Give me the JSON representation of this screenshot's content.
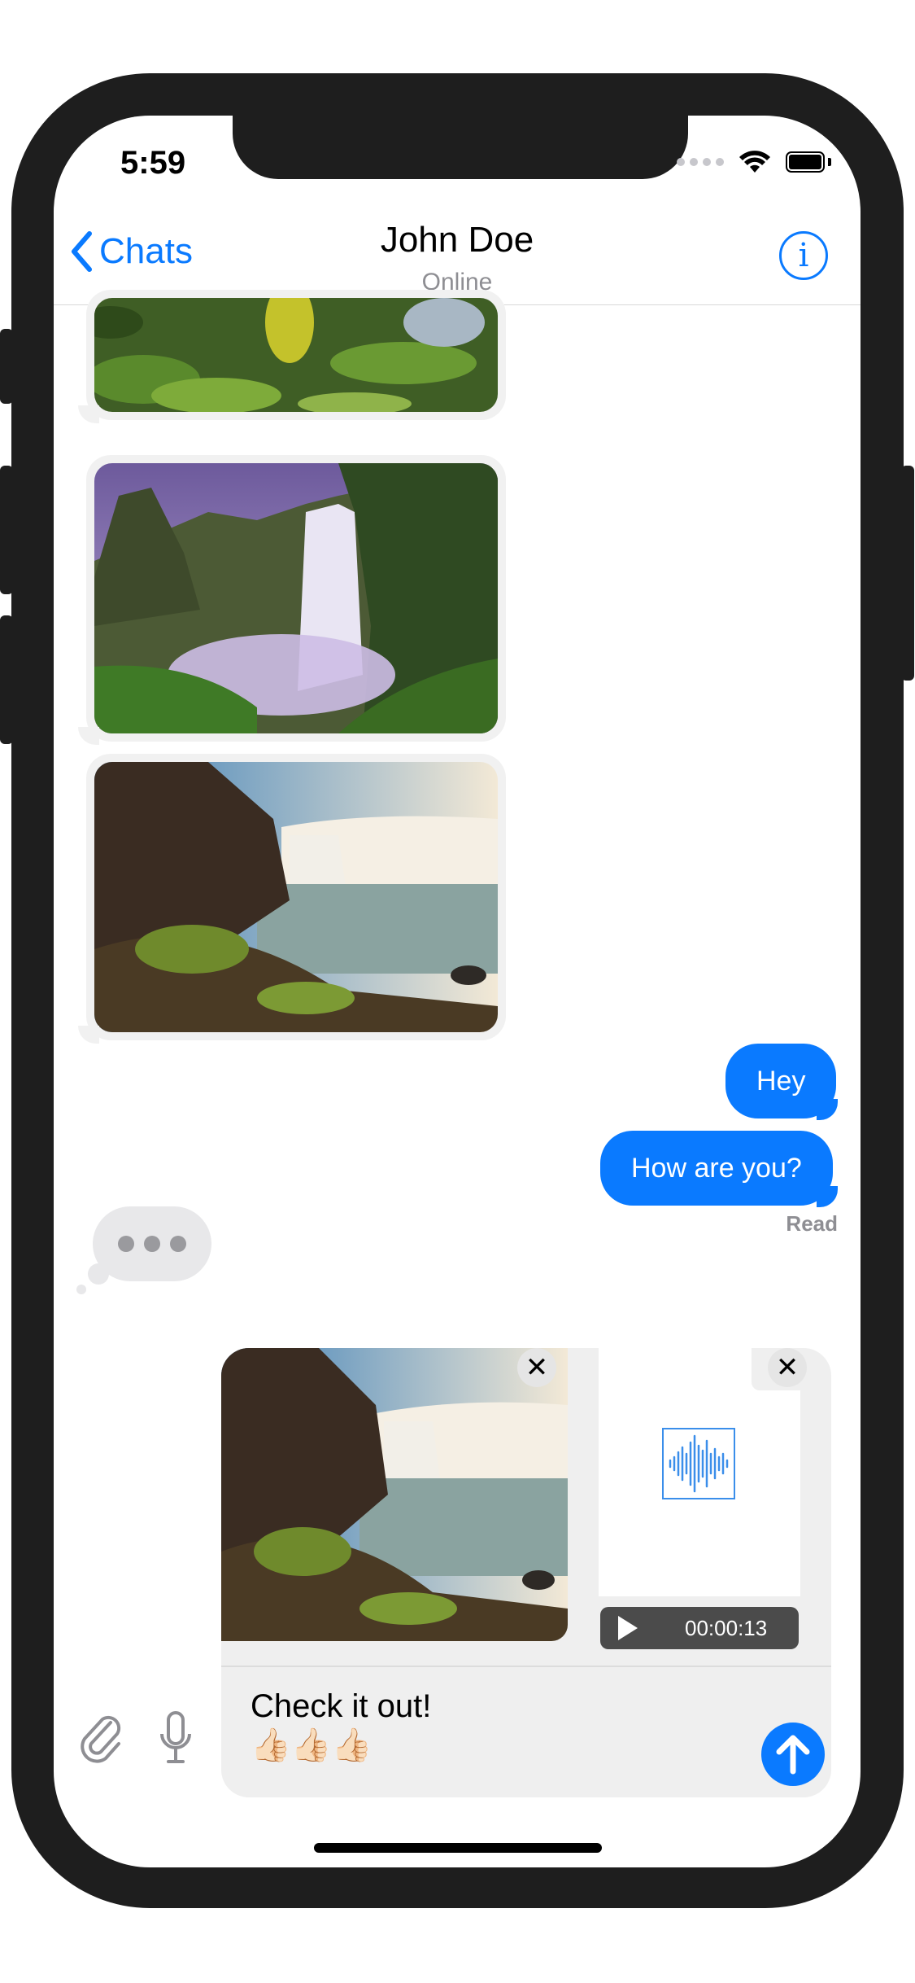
{
  "status_bar": {
    "time": "5:59"
  },
  "nav": {
    "back_label": "Chats",
    "title": "John Doe",
    "subtitle": "Online"
  },
  "messages": {
    "outgoing": [
      {
        "text": "Hey"
      },
      {
        "text": "How are you?"
      }
    ],
    "read_receipt": "Read"
  },
  "composer": {
    "audio_duration": "00:00:13",
    "text_line1": "Check it out!",
    "text_line2": "👍🏻👍🏻👍🏻"
  },
  "colors": {
    "accent": "#0a7aff",
    "bubble_incoming": "#f1f1f1",
    "typing_bubble": "#e8e8ea"
  },
  "icons": {
    "back": "chevron-left-icon",
    "info": "info-icon",
    "attach": "paperclip-icon",
    "mic": "microphone-icon",
    "send": "arrow-up-icon",
    "close": "close-icon",
    "play": "play-icon",
    "waveform": "waveform-icon"
  }
}
